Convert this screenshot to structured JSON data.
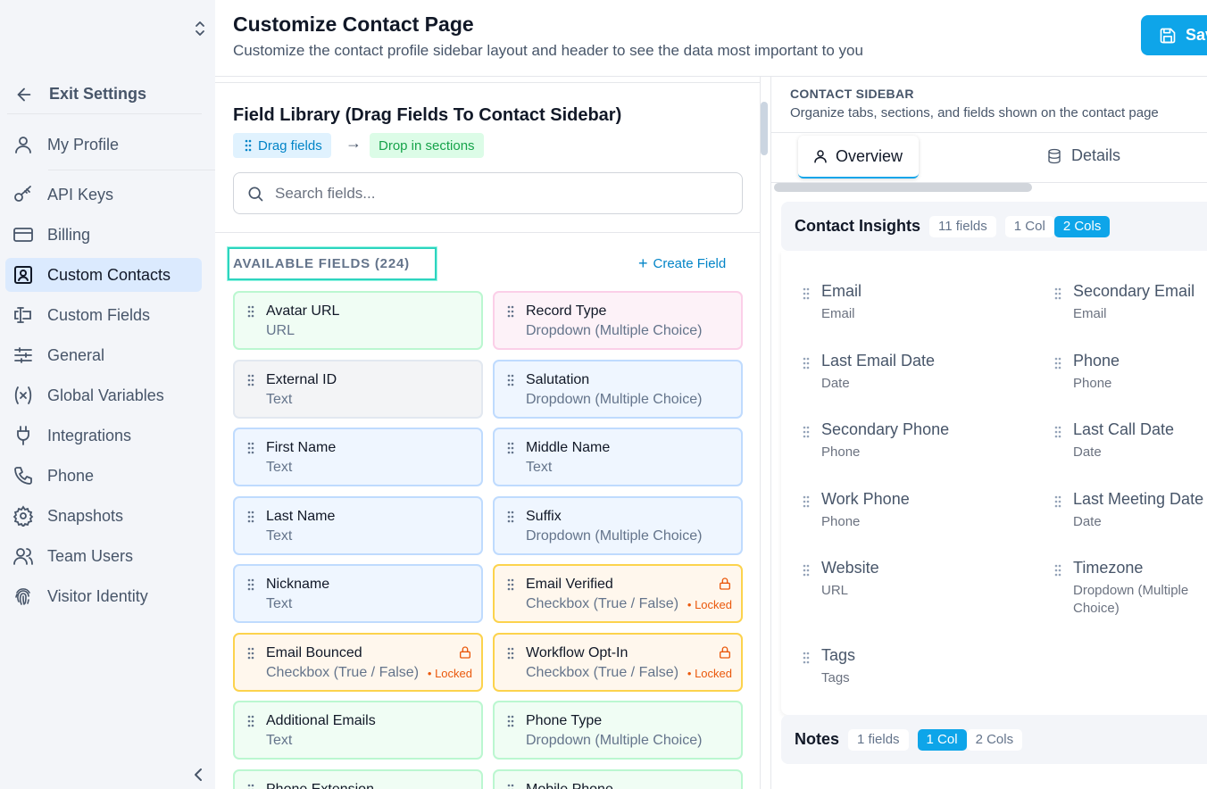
{
  "sidebar": {
    "exit": "Exit Settings",
    "items": [
      {
        "label": "My Profile",
        "icon": "user-icon"
      },
      {
        "label": "API Keys",
        "icon": "key-icon"
      },
      {
        "label": "Billing",
        "icon": "credit-card-icon"
      },
      {
        "label": "Custom Contacts",
        "icon": "contact-card-icon",
        "active": true
      },
      {
        "label": "Custom Fields",
        "icon": "text-cursor-icon"
      },
      {
        "label": "General",
        "icon": "sliders-icon"
      },
      {
        "label": "Global Variables",
        "icon": "variable-icon"
      },
      {
        "label": "Integrations",
        "icon": "plug-icon"
      },
      {
        "label": "Phone",
        "icon": "phone-icon"
      },
      {
        "label": "Snapshots",
        "icon": "gear-icon"
      },
      {
        "label": "Team Users",
        "icon": "users-icon"
      },
      {
        "label": "Visitor Identity",
        "icon": "fingerprint-icon"
      }
    ]
  },
  "header": {
    "title": "Customize Contact Page",
    "subtitle": "Customize the contact profile sidebar layout and header to see the data most important to you",
    "save": "Save"
  },
  "library": {
    "title": "Field Library (Drag Fields To Contact Sidebar)",
    "drag_chip": "Drag fields",
    "arrow": "→",
    "drop_chip": "Drop in sections",
    "search_placeholder": "Search fields...",
    "available_label": "AVAILABLE FIELDS (224)",
    "create_field": "Create Field",
    "locked_label": "• Locked",
    "fields": [
      {
        "name": "Avatar URL",
        "type": "URL",
        "color": "green"
      },
      {
        "name": "Record Type",
        "type": "Dropdown (Multiple Choice)",
        "color": "pink"
      },
      {
        "name": "External ID",
        "type": "Text",
        "color": "gray"
      },
      {
        "name": "Salutation",
        "type": "Dropdown (Multiple Choice)",
        "color": "blue"
      },
      {
        "name": "First Name",
        "type": "Text",
        "color": "blue"
      },
      {
        "name": "Middle Name",
        "type": "Text",
        "color": "blue"
      },
      {
        "name": "Last Name",
        "type": "Text",
        "color": "blue"
      },
      {
        "name": "Suffix",
        "type": "Dropdown (Multiple Choice)",
        "color": "blue"
      },
      {
        "name": "Nickname",
        "type": "Text",
        "color": "blue"
      },
      {
        "name": "Email Verified",
        "type": "Checkbox (True / False)",
        "color": "orange",
        "locked": true
      },
      {
        "name": "Email Bounced",
        "type": "Checkbox (True / False)",
        "color": "orange",
        "locked": true
      },
      {
        "name": "Workflow Opt-In",
        "type": "Checkbox (True / False)",
        "color": "orange",
        "locked": true
      },
      {
        "name": "Additional Emails",
        "type": "Text",
        "color": "green"
      },
      {
        "name": "Phone Type",
        "type": "Dropdown (Multiple Choice)",
        "color": "green"
      },
      {
        "name": "Phone Extension",
        "type": "",
        "color": "green"
      },
      {
        "name": "Mobile Phone",
        "type": "",
        "color": "green"
      }
    ]
  },
  "contact_sidebar": {
    "title": "CONTACT SIDEBAR",
    "subtitle": "Organize tabs, sections, and fields shown on the contact page",
    "tabs": [
      {
        "label": "Overview",
        "active": true
      },
      {
        "label": "Details"
      }
    ],
    "sections": [
      {
        "name": "Contact Insights",
        "count": "11 fields",
        "opt1": "1 Col",
        "opt2": "2 Cols",
        "selected": "2 Cols",
        "fields": [
          {
            "name": "Email",
            "type": "Email"
          },
          {
            "name": "Secondary Email",
            "type": "Email"
          },
          {
            "name": "Last Email Date",
            "type": "Date"
          },
          {
            "name": "Phone",
            "type": "Phone"
          },
          {
            "name": "Secondary Phone",
            "type": "Phone"
          },
          {
            "name": "Last Call Date",
            "type": "Date"
          },
          {
            "name": "Work Phone",
            "type": "Phone"
          },
          {
            "name": "Last Meeting Date",
            "type": "Date"
          },
          {
            "name": "Website",
            "type": "URL"
          },
          {
            "name": "Timezone",
            "type": "Dropdown (Multiple Choice)"
          },
          {
            "name": "Tags",
            "type": "Tags"
          }
        ]
      },
      {
        "name": "Notes",
        "count": "1 fields",
        "opt1": "1 Col",
        "opt2": "2 Cols",
        "selected": "1 Col"
      }
    ]
  }
}
